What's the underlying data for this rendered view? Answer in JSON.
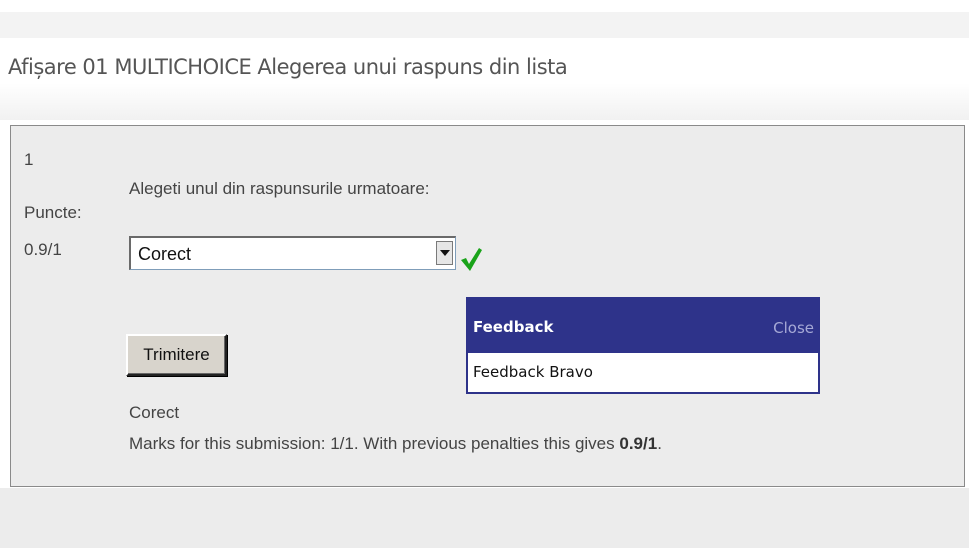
{
  "page": {
    "title": "Afișare 01 MULTICHOICE Alegerea unui raspuns din lista"
  },
  "question": {
    "number": "1",
    "grade_label": "Puncte:",
    "grade_value": "0.9/1",
    "text": "Alegeti unul din raspunsurile urmatoare:",
    "selected_answer": "Corect",
    "correct_icon": "check-icon",
    "submit_label": "Trimitere",
    "status_text": "Corect",
    "marks_text": "Marks for this submission: 1/1. With previous penalties this gives ",
    "marks_final": "0.9/1",
    "marks_end": "."
  },
  "feedback": {
    "title": "Feedback",
    "close_label": "Close",
    "body": "Feedback Bravo"
  },
  "colors": {
    "feedback_header": "#2e338a",
    "check_green": "#1aa31a",
    "question_bg": "#ececec"
  }
}
